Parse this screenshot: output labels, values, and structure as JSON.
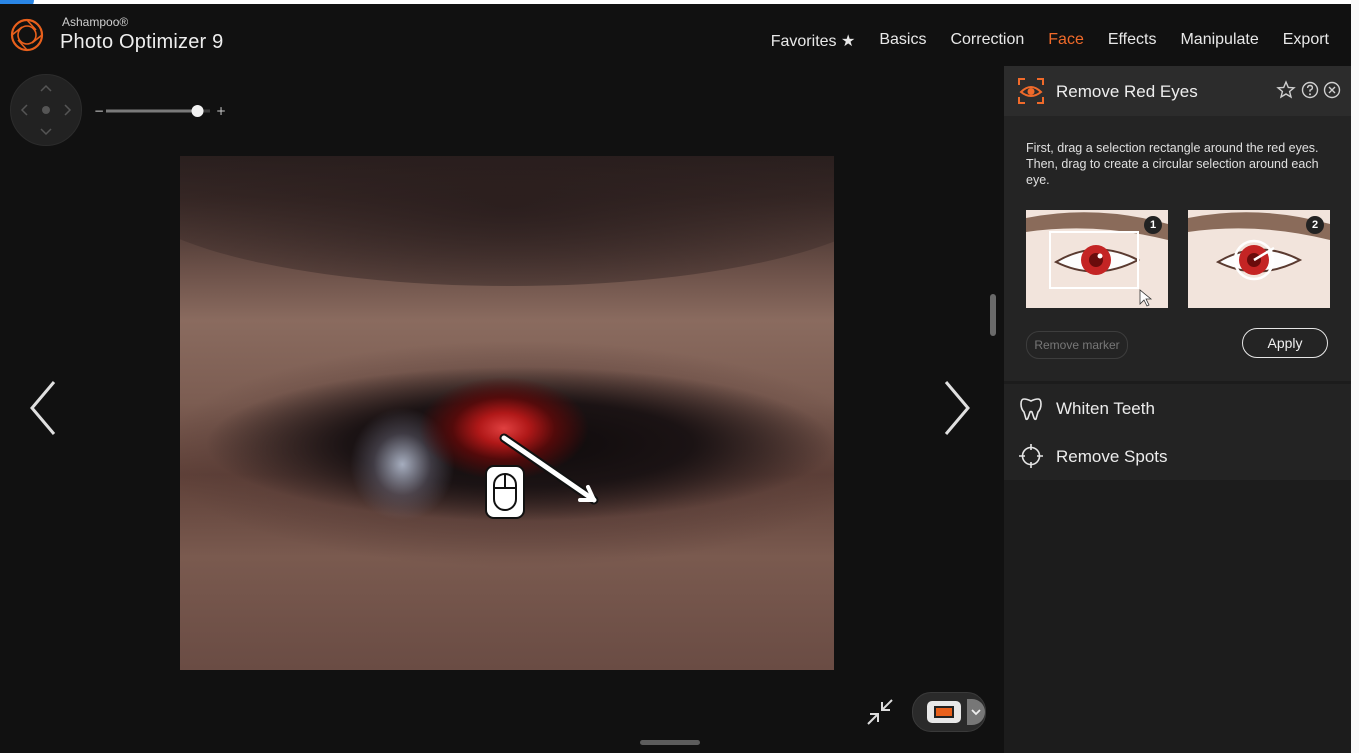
{
  "app": {
    "brand_small": "Ashampoo®",
    "brand_title": "Photo Optimizer 9"
  },
  "menu": {
    "items": [
      {
        "label": "Favorites ★"
      },
      {
        "label": "Basics"
      },
      {
        "label": "Correction"
      },
      {
        "label": "Face",
        "active": true
      },
      {
        "label": "Effects"
      },
      {
        "label": "Manipulate"
      },
      {
        "label": "Export"
      }
    ]
  },
  "zoom": {
    "minus": "−",
    "plus": "+",
    "level": 0.88
  },
  "panel": {
    "remove_red_eyes": {
      "title": "Remove Red Eyes",
      "instructions": "First, drag a selection rectangle around the red eyes. Then, drag to create a circular selection around each eye.",
      "example_1_badge": "1",
      "example_2_badge": "2",
      "remove_marker": "Remove marker",
      "apply": "Apply"
    },
    "tools": {
      "whiten_teeth": "Whiten Teeth",
      "remove_spots": "Remove Spots"
    }
  },
  "colors": {
    "accent": "#f06a2a",
    "background": "#111111",
    "panel": "#1c1c1c",
    "highlight_blue": "#2a86e6"
  },
  "icons": [
    "ashampoo-logo-icon",
    "nav-pad-icon",
    "chevron-left-icon",
    "chevron-right-icon",
    "red-eye-icon",
    "star-icon",
    "help-icon",
    "close-icon",
    "tooth-icon",
    "crosshair-icon",
    "collapse-icon",
    "mouse-icon",
    "compare-view-icon"
  ]
}
